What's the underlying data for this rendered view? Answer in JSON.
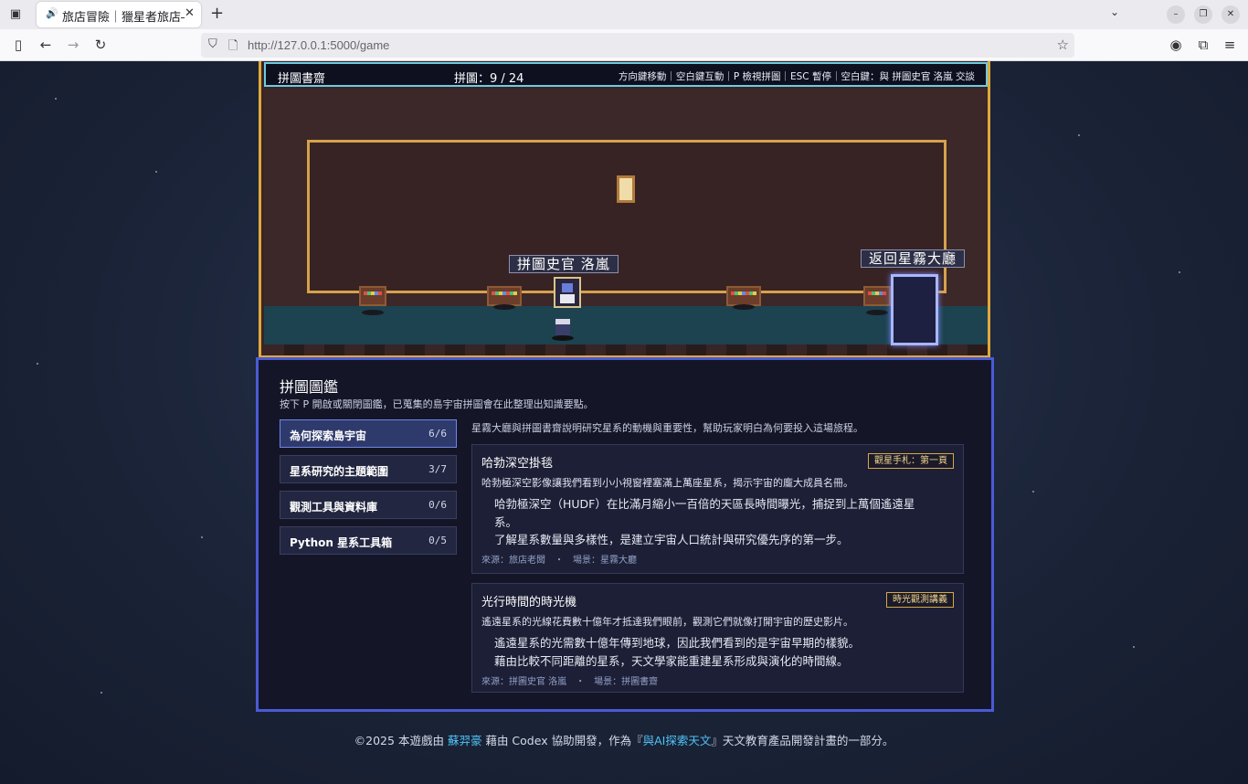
{
  "browser": {
    "tab_title": "旅店冒險｜獵星者旅店—",
    "url": "http://127.0.0.1:5000/game"
  },
  "hud": {
    "location": "拼圖書齋",
    "puzzle_count": "拼圖：9 / 24",
    "help": "方向鍵移動｜空白鍵互動｜P 檢視拼圖｜ESC 暫停｜空白鍵：與 拼圖史官 洛嵐 交談"
  },
  "scene": {
    "npc_label": "拼圖史官 洛嵐",
    "exit_label": "返回星霧大廳"
  },
  "panel": {
    "title": "拼圖圖鑑",
    "subtitle": "按下 P 開啟或關閉圖鑑，已蒐集的島宇宙拼圖會在此整理出知識要點。",
    "categories": [
      {
        "label": "為何探索島宇宙",
        "count": "6/6"
      },
      {
        "label": "星系研究的主題範圍",
        "count": "3/7"
      },
      {
        "label": "觀測工具與資料庫",
        "count": "0/6"
      },
      {
        "label": "Python 星系工具箱",
        "count": "0/5"
      }
    ],
    "intro": "星霧大廳與拼圖書齋說明研究星系的動機與重要性，幫助玩家明白為何要投入這場旅程。",
    "cards": [
      {
        "title": "哈勃深空掛毯",
        "badge": "觀星手札：第一頁",
        "desc": "哈勃極深空影像讓我們看到小小視窗裡塞滿上萬座星系，揭示宇宙的龐大成員名冊。",
        "point1": "哈勃極深空（HUDF）在比滿月縮小一百倍的天區長時間曝光，捕捉到上萬個遙遠星系。",
        "point2": "了解星系數量與多樣性，是建立宇宙人口統計與研究優先序的第一步。",
        "source": "來源：旅店老闆　・　場景：星霧大廳"
      },
      {
        "title": "光行時間的時光機",
        "badge": "時光觀測講義",
        "desc": "遙遠星系的光線花費數十億年才抵達我們眼前，觀測它們就像打開宇宙的歷史影片。",
        "point1": "遙遠星系的光需數十億年傳到地球，因此我們看到的是宇宙早期的樣貌。",
        "point2": "藉由比較不同距離的星系，天文學家能重建星系形成與演化的時間線。",
        "source": "來源：拼圖史官 洛嵐　・　場景：拼圖書齋"
      }
    ]
  },
  "footer": {
    "prefix": "©2025 本遊戲由",
    "author": "蘇羿豪",
    "middle": "藉由 Codex 協助開發，作為『",
    "project": "與AI探索天文",
    "suffix": "』天文教育產品開發計畫的一部分。"
  }
}
